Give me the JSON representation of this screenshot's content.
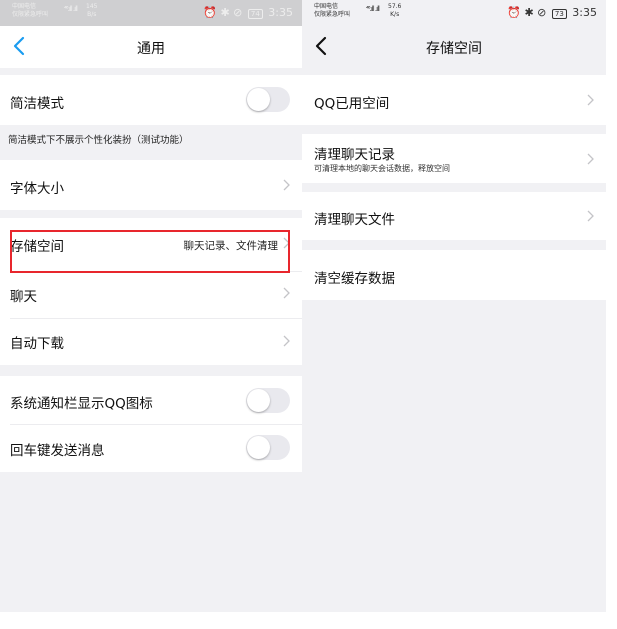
{
  "left": {
    "status_bar": {
      "carrier_line1": "中国电信",
      "carrier_line2": "仅限紧急呼叫",
      "signal": "⁴⁶.ıll .ıll",
      "speed_value": "145",
      "speed_unit": "B/s",
      "icons": "⏰ ✱ ⊘",
      "battery": "74",
      "time": "3:35"
    },
    "nav": {
      "back_icon": "chevron-left-icon",
      "title": "通用"
    },
    "items": [
      {
        "label": "简洁模式",
        "control": "toggle",
        "on": false
      },
      {
        "label": "字体大小"
      },
      {
        "label": "存储空间",
        "value": "聊天记录、文件清理"
      },
      {
        "label": "聊天"
      },
      {
        "label": "自动下载"
      },
      {
        "label": "系统通知栏显示QQ图标",
        "control": "toggle",
        "on": false
      },
      {
        "label": "回车键发送消息",
        "control": "toggle",
        "on": false
      }
    ],
    "simple_mode_hint": "简洁模式下不展示个性化装扮（测试功能）"
  },
  "right": {
    "status_bar": {
      "carrier_line1": "中国电信",
      "carrier_line2": "仅限紧急呼叫",
      "signal": "⁴⁶.ıll .ıll",
      "speed_value": "57.6",
      "speed_unit": "K/s",
      "icons": "⏰ ✱ ⊘",
      "battery": "73",
      "time": "3:35"
    },
    "nav": {
      "back_icon": "chevron-left-icon",
      "title": "存储空间"
    },
    "items": [
      {
        "label": "QQ已用空间"
      },
      {
        "label": "清理聊天记录",
        "sublabel": "可清理本地的聊天会话数据，释放空间"
      },
      {
        "label": "清理聊天文件"
      },
      {
        "label": "清空缓存数据"
      }
    ]
  },
  "colors": {
    "background": "#f1f1f4",
    "cell": "#ffffff",
    "toggle_off": "#e9e9ee",
    "chevron": "#c4c4c8",
    "highlight_box": "#e8262d"
  }
}
